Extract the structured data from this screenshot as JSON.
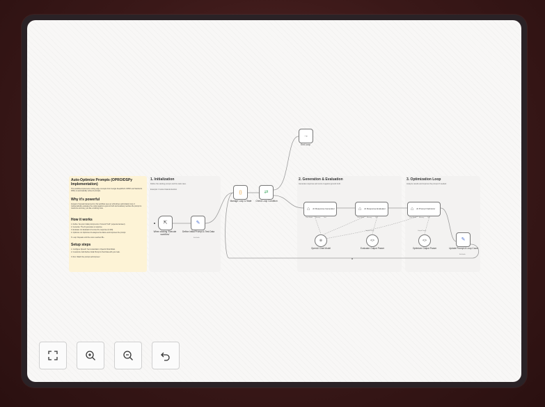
{
  "sticky": {
    "title": "Auto-Optimize Prompts (OPRO/DSPy Implementation)",
    "intro": "This workflow implements cutting-edge concepts from Google DeepMind's OPRO and Stanford's DSPy to automatically refine AI prompts.",
    "why_heading": "Why it's powerful",
    "why_text": "Instead of manual trial-and-error, this workflow uses an LLM-driven optimization loop. It mathematically evaluates the output against a ground truth and iteratively rewrites the prompt to maximize accuracy, just like a training code.",
    "how_heading": "How it works",
    "how_items": [
      "1. Define: Set your initial prompt and a \"Ground Truth\" (expected answer).",
      "2. Generate: The AI generates a response.",
      "3. Evaluate: An Evaluator AI scores the response (0-100).",
      "4. Optimize: An Optimizer AI analyzes the failure and improves the prompt.",
      "5. Loop: Repeats until the score reaches 95+."
    ],
    "setup_heading": "Setup steps",
    "setup_items": [
      "1. Configure OpenAI: Set credentials in OpenAI Chat Model.",
      "2. Customize: Edit Define Initial Prompt & Test Data with your task.",
      "3. Run: Watch the prompt self-improve!"
    ]
  },
  "sections": {
    "init": {
      "title": "1. Initialization",
      "desc": "Define the starting prompt and the task case.",
      "example": "Example: Invoice Data Extraction"
    },
    "gen": {
      "title": "2. Generation & Evaluation",
      "desc": "Generate response and score it against ground truth."
    },
    "opt": {
      "title": "3. Optimization Loop",
      "desc": "Analyze results and improve the prompt if needed."
    }
  },
  "nodes": {
    "trigger": {
      "label": "When clicking 'Execute workflow'",
      "icon": "cursor-click-icon"
    },
    "define": {
      "label": "Define Initial Prompt & Test Data",
      "sub": "Edit fields",
      "icon": "pencil-icon"
    },
    "manage": {
      "label": "Manage Loop & State",
      "icon": "code-braces-icon"
    },
    "check": {
      "label": "Check Loop Condition",
      "icon": "branch-icon"
    },
    "end": {
      "label": "End Loop",
      "icon": "arrow-right-icon"
    },
    "gen_agent": {
      "label": "AI Response Generator",
      "icon": "robot-icon"
    },
    "eval_agent": {
      "label": "AI Response Evaluator",
      "icon": "robot-icon"
    },
    "opt_agent": {
      "label": "AI Prompt Optimizer",
      "icon": "robot-icon"
    },
    "openai": {
      "label": "OpenAI Chat Model",
      "icon": "openai-icon"
    },
    "eval_parser": {
      "label": "Evaluator Output Parser",
      "icon": "code-icon"
    },
    "opt_parser": {
      "label": "Optimizer Output Parser",
      "icon": "code-icon"
    },
    "update": {
      "label": "Update Prompt & Loop Count",
      "sub": "Edit fields",
      "icon": "pencil-icon"
    }
  },
  "ports": {
    "chat_model": "Chat Model",
    "memory": "Memory",
    "tool": "Tool",
    "output_parser": "Output Parser"
  },
  "toolbar": [
    "fit-view-icon",
    "zoom-in-icon",
    "zoom-out-icon",
    "reset-zoom-icon"
  ]
}
